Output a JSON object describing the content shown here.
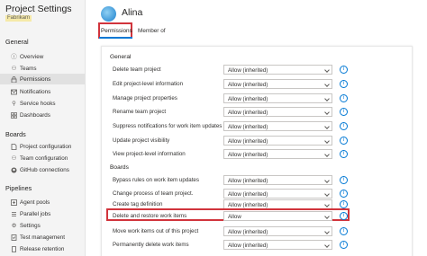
{
  "sidebar": {
    "title": "Project Settings",
    "subtitle": "Fabrikam",
    "sections": [
      {
        "title": "General",
        "items": [
          {
            "label": "Overview",
            "icon": "info-icon"
          },
          {
            "label": "Teams",
            "icon": "people-icon"
          },
          {
            "label": "Permissions",
            "icon": "lock-icon",
            "active": true
          },
          {
            "label": "Notifications",
            "icon": "bell-icon"
          },
          {
            "label": "Service hooks",
            "icon": "hook-icon"
          },
          {
            "label": "Dashboards",
            "icon": "dashboard-icon"
          }
        ]
      },
      {
        "title": "Boards",
        "items": [
          {
            "label": "Project configuration",
            "icon": "document-icon"
          },
          {
            "label": "Team configuration",
            "icon": "people-settings-icon"
          },
          {
            "label": "GitHub connections",
            "icon": "github-icon"
          }
        ]
      },
      {
        "title": "Pipelines",
        "items": [
          {
            "label": "Agent pools",
            "icon": "agent-pool-icon"
          },
          {
            "label": "Parallel jobs",
            "icon": "parallel-icon"
          },
          {
            "label": "Settings",
            "icon": "gear-icon"
          },
          {
            "label": "Test management",
            "icon": "test-icon"
          },
          {
            "label": "Release retention",
            "icon": "phone-icon"
          }
        ]
      }
    ]
  },
  "user": {
    "name": "Alina",
    "avatar": "user-avatar"
  },
  "tabs": [
    {
      "label": "Permissions",
      "selected": true
    },
    {
      "label": "Member of",
      "selected": false
    }
  ],
  "permissions": {
    "general": {
      "title": "General",
      "rows": [
        {
          "label": "Delete team project",
          "value": "Allow (inherited)"
        },
        {
          "label": "Edit project-level information",
          "value": "Allow (inherited)"
        },
        {
          "label": "Manage project properties",
          "value": "Allow (inherited)"
        },
        {
          "label": "Rename team project",
          "value": "Allow (inherited)"
        },
        {
          "label": "Suppress notifications for work item updates",
          "value": "Allow (inherited)"
        },
        {
          "label": "Update project visibility",
          "value": "Allow (inherited)"
        },
        {
          "label": "View project-level information",
          "value": "Allow (inherited)"
        }
      ]
    },
    "boards": {
      "title": "Boards",
      "rows": [
        {
          "label": "Bypass rules on work item updates",
          "value": "Allow (inherited)"
        },
        {
          "label": "Change process of team project.",
          "value": "Allow (inherited)"
        },
        {
          "label": "Create tag definition",
          "value": "Allow (inherited)"
        },
        {
          "label": "Delete and restore work items",
          "value": "Allow",
          "highlighted": true
        },
        {
          "label": "Move work items out of this project",
          "value": "Allow (inherited)"
        },
        {
          "label": "Permanently delete work items",
          "value": "Allow (inherited)"
        }
      ]
    }
  },
  "colors": {
    "accent": "#0078d4",
    "highlight": "#d1343c",
    "sidebar_bg": "#f4f4f4"
  }
}
